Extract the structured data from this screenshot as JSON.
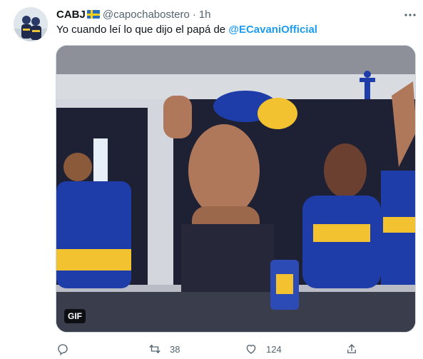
{
  "tweet": {
    "author_name": "CABJ",
    "author_flag_icon": "sweden-flag-icon",
    "handle": "@capochabostero",
    "separator": "·",
    "time": "1h",
    "text_before": "Yo cuando leí lo que dijo el papá de ",
    "mention": "@ECavaniOfficial",
    "media_badge": "GIF"
  },
  "actions": {
    "reply_icon": "reply-icon",
    "retweet_icon": "retweet-icon",
    "retweet_count": "38",
    "like_icon": "heart-icon",
    "like_count": "124",
    "share_icon": "share-icon"
  },
  "colors": {
    "accent": "#1d9bf0",
    "muted": "#536471",
    "text": "#0f1419",
    "boca_blue": "#1f3da8",
    "boca_yellow": "#f2c230"
  }
}
